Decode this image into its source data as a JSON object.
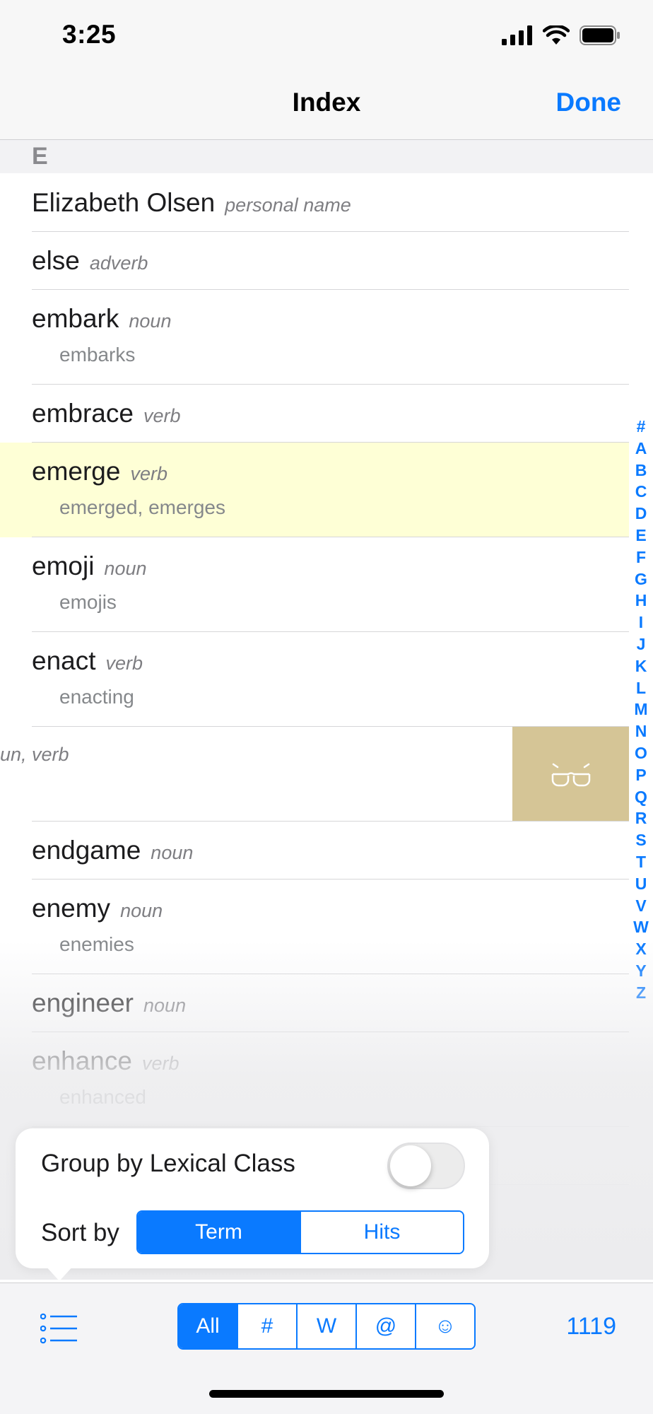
{
  "status_bar": {
    "time": "3:25"
  },
  "nav": {
    "title": "Index",
    "done_label": "Done"
  },
  "section": {
    "letter": "E"
  },
  "entries": [
    {
      "term": "Elizabeth Olsen",
      "class": "personal name",
      "forms": ""
    },
    {
      "term": "else",
      "class": "adverb",
      "forms": ""
    },
    {
      "term": "embark",
      "class": "noun",
      "forms": "embarks"
    },
    {
      "term": "embrace",
      "class": "verb",
      "forms": ""
    },
    {
      "term": "emerge",
      "class": "verb",
      "forms": "emerged, emerges",
      "highlighted": true
    },
    {
      "term": "emoji",
      "class": "noun",
      "forms": "emojis"
    },
    {
      "term": "enact",
      "class": "verb",
      "forms": "enacting"
    },
    {
      "term": "",
      "class": "un, verb",
      "forms": "",
      "swiped": true,
      "action_icon": "glasses-icon",
      "action_color": "#d5c596"
    },
    {
      "term": "endgame",
      "class": "noun",
      "forms": ""
    },
    {
      "term": "enemy",
      "class": "noun",
      "forms": "enemies"
    },
    {
      "term": "engineer",
      "class": "noun",
      "forms": ""
    },
    {
      "term": "enhance",
      "class": "verb",
      "forms": "enhanced"
    }
  ],
  "index_letters": [
    "#",
    "A",
    "B",
    "C",
    "D",
    "E",
    "F",
    "G",
    "H",
    "I",
    "J",
    "K",
    "L",
    "M",
    "N",
    "O",
    "P",
    "Q",
    "R",
    "S",
    "T",
    "U",
    "V",
    "W",
    "X",
    "Y",
    "Z"
  ],
  "popover": {
    "group_label": "Group by Lexical Class",
    "group_enabled": false,
    "sort_label": "Sort by",
    "sort_options": [
      "Term",
      "Hits"
    ],
    "sort_selected": "Term"
  },
  "toolbar": {
    "list_icon": "list-icon",
    "filters": [
      "All",
      "#",
      "W",
      "@",
      "☺"
    ],
    "filter_selected": "All",
    "count": "1119"
  },
  "colors": {
    "accent": "#0a7aff",
    "highlight": "#feffd6",
    "swipe_action": "#d5c596"
  }
}
